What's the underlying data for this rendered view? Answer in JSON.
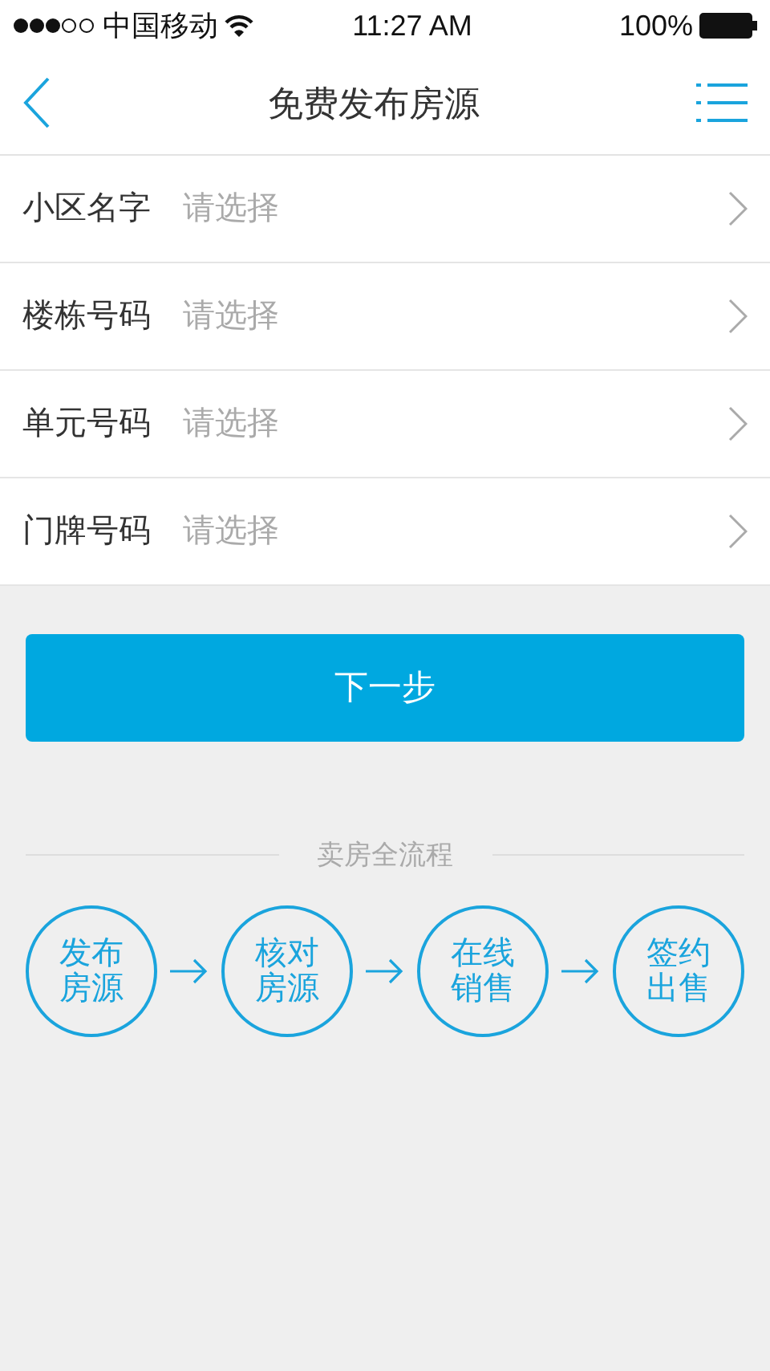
{
  "status_bar": {
    "carrier": "中国移动",
    "time": "11:27 AM",
    "battery": "100%"
  },
  "nav": {
    "title": "免费发布房源"
  },
  "form_rows": [
    {
      "label": "小区名字",
      "placeholder": "请选择"
    },
    {
      "label": "楼栋号码",
      "placeholder": "请选择"
    },
    {
      "label": "单元号码",
      "placeholder": "请选择"
    },
    {
      "label": "门牌号码",
      "placeholder": "请选择"
    }
  ],
  "next_button": "下一步",
  "process": {
    "title": "卖房全流程",
    "steps": [
      "发布房源",
      "核对房源",
      "在线销售",
      "签约出售"
    ]
  }
}
